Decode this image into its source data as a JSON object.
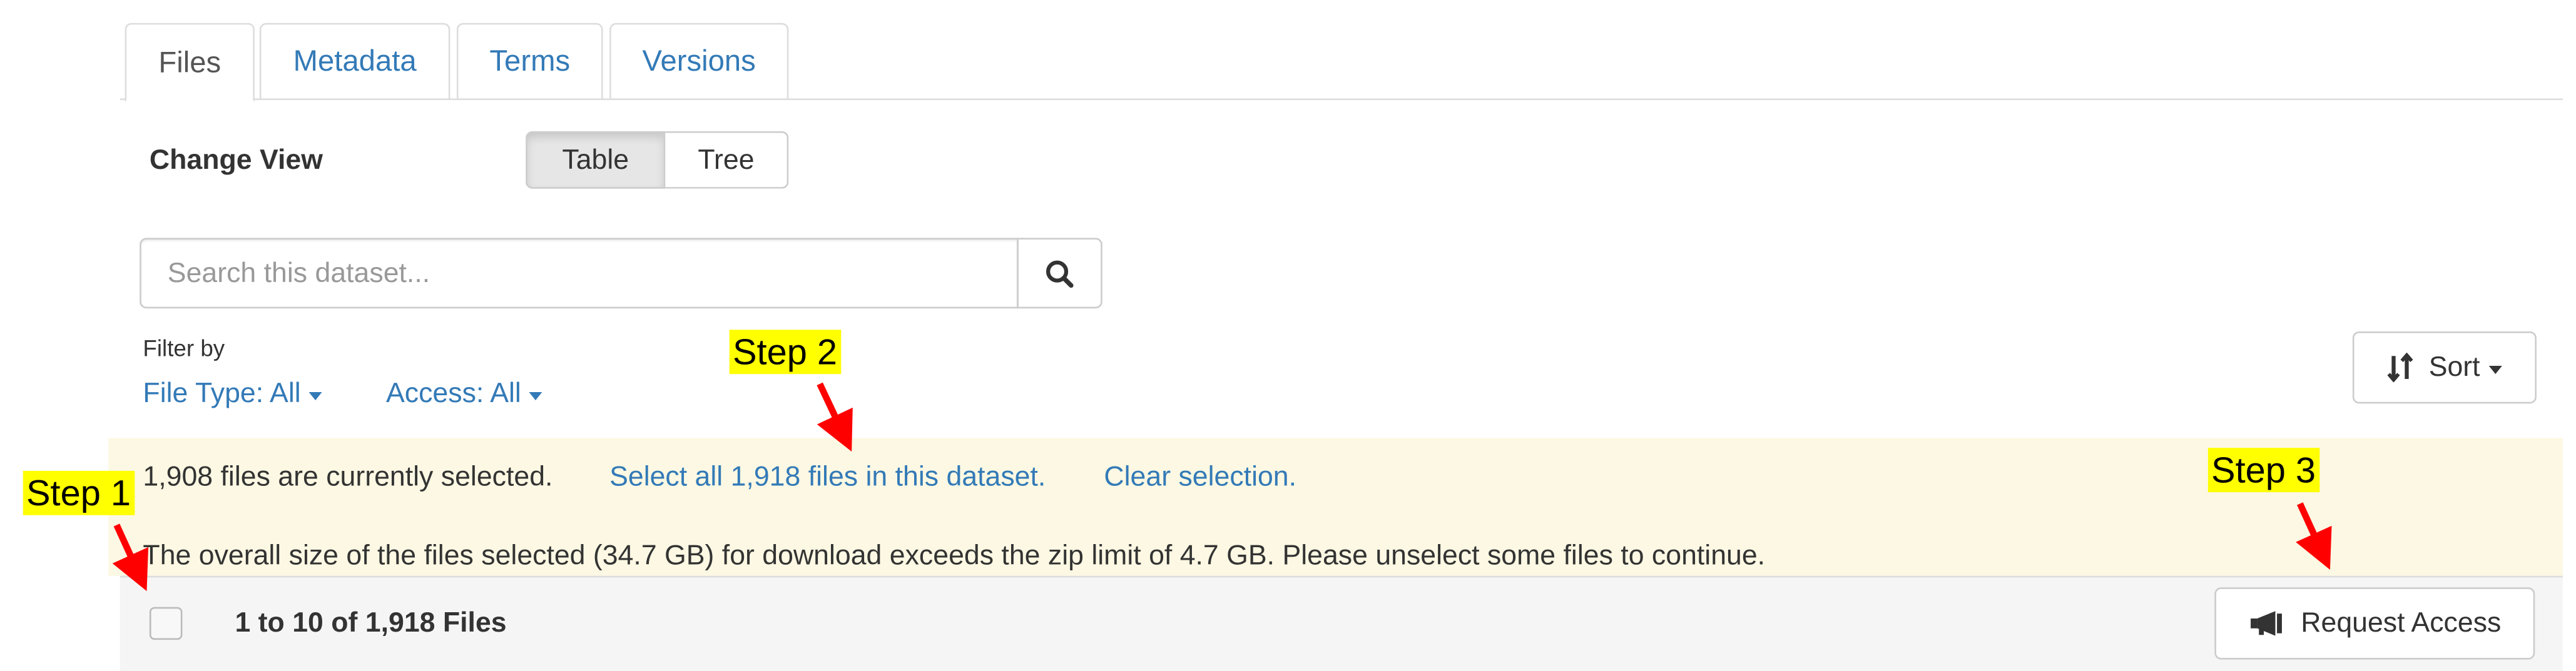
{
  "tabs": [
    {
      "label": "Files",
      "active": true
    },
    {
      "label": "Metadata",
      "active": false
    },
    {
      "label": "Terms",
      "active": false
    },
    {
      "label": "Versions",
      "active": false
    }
  ],
  "change_view": {
    "label": "Change View",
    "options": [
      "Table",
      "Tree"
    ],
    "selected": "Table"
  },
  "search": {
    "placeholder": "Search this dataset...",
    "value": "",
    "icon": "search-icon"
  },
  "filter": {
    "label": "Filter by",
    "file_type": "File Type: All",
    "access": "Access: All"
  },
  "sort": {
    "label": "Sort",
    "icon": "sort-arrows-icon"
  },
  "selection_alert": {
    "selected_text": "1,908 files are currently selected.",
    "select_all_link": "Select all 1,918 files in this dataset.",
    "clear_link": "Clear selection.",
    "size_warning": "The overall size of the files selected (34.7 GB) for download exceeds the zip limit of 4.7 GB. Please unselect some files to continue.",
    "background": "#fcf8e3"
  },
  "table_header": {
    "count_text": "1 to 10 of 1,918 Files",
    "request_access_label": "Request Access",
    "request_access_icon": "megaphone-icon"
  },
  "annotations": {
    "step1": "Step 1",
    "step2": "Step 2",
    "step3": "Step 3",
    "highlight_color": "#ffff00",
    "arrow_color": "#ff0000"
  },
  "colors": {
    "link": "#337ab7",
    "text": "#333333",
    "border": "#cccccc"
  }
}
